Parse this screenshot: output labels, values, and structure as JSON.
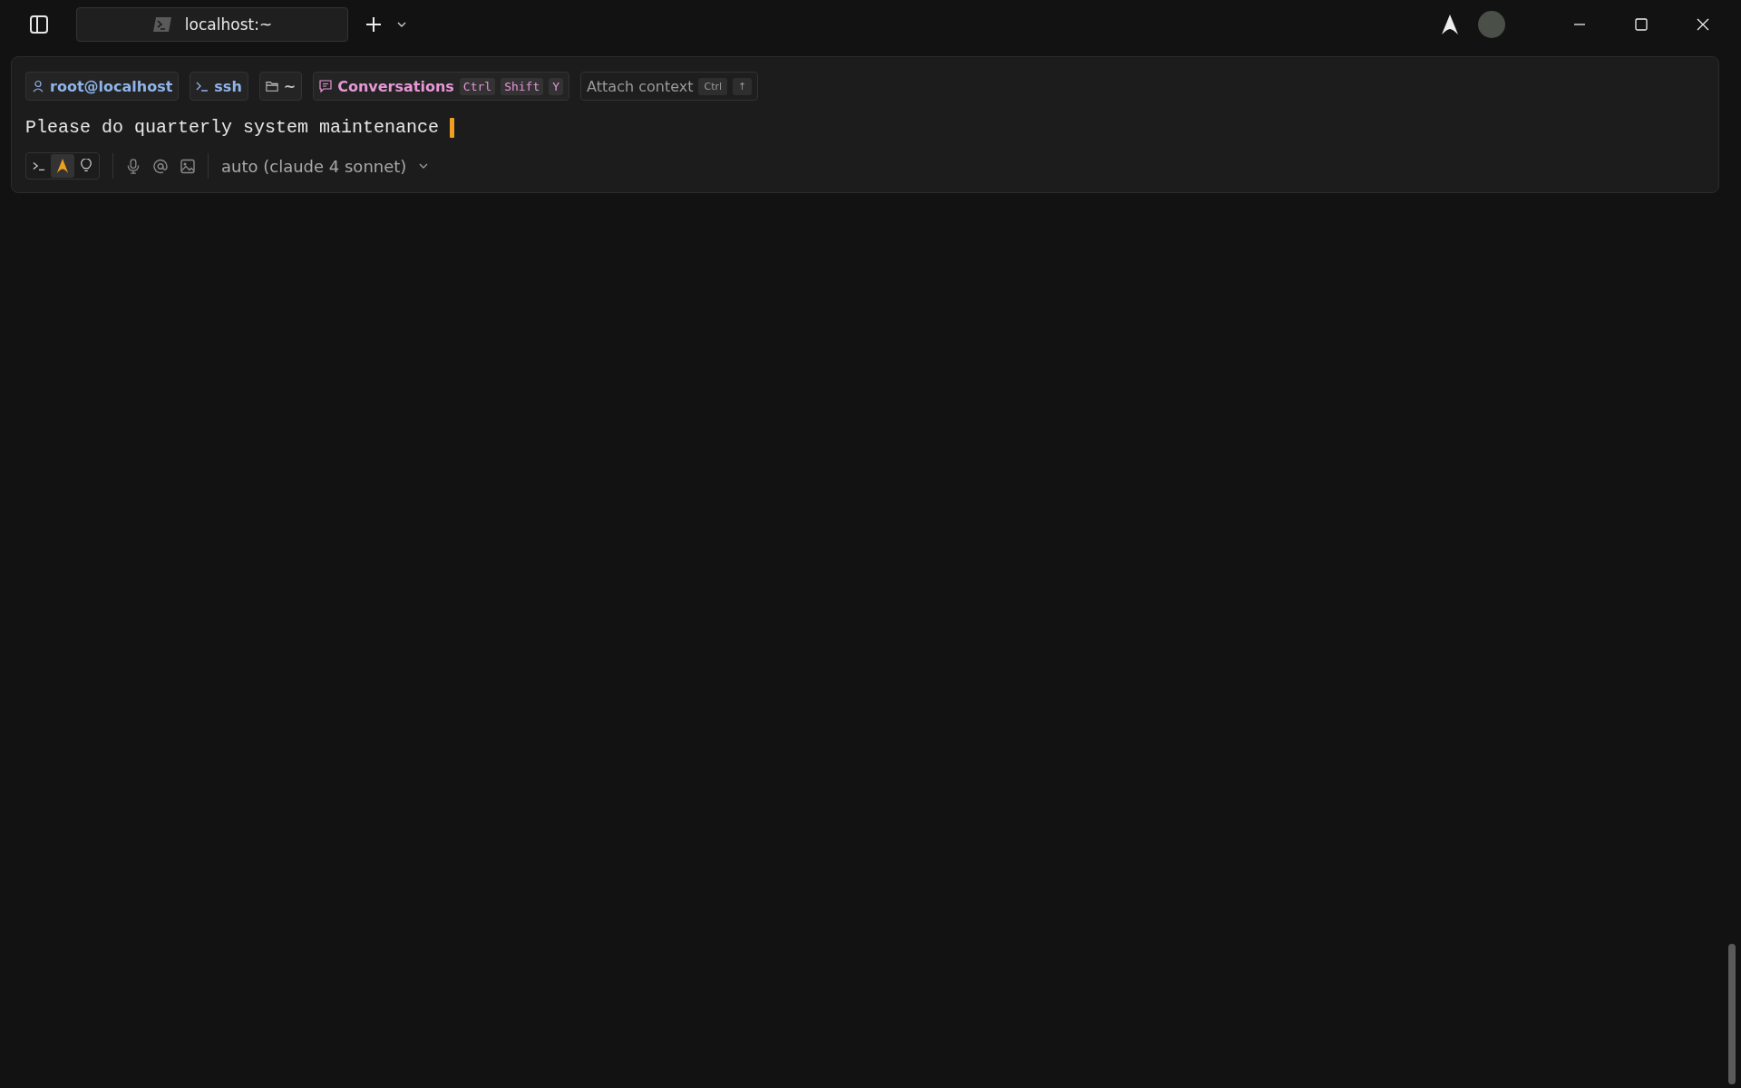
{
  "tab": {
    "title": "localhost:~"
  },
  "context_chips": [
    {
      "kind": "user",
      "label": "root@localhost"
    },
    {
      "kind": "shell",
      "label": "ssh"
    },
    {
      "kind": "folder",
      "label": "~"
    },
    {
      "kind": "conversations",
      "label": "Conversations",
      "keys": [
        "Ctrl",
        "Shift",
        "Y"
      ]
    },
    {
      "kind": "attach",
      "label": "Attach context",
      "keys": [
        "Ctrl",
        "↑"
      ]
    }
  ],
  "prompt": {
    "value": "Please do quarterly system maintenance"
  },
  "modes": [
    {
      "kind": "terminal",
      "selected": false
    },
    {
      "kind": "agent",
      "selected": true
    },
    {
      "kind": "idea",
      "selected": false
    }
  ],
  "model": {
    "label": "auto (claude 4 sonnet)"
  }
}
